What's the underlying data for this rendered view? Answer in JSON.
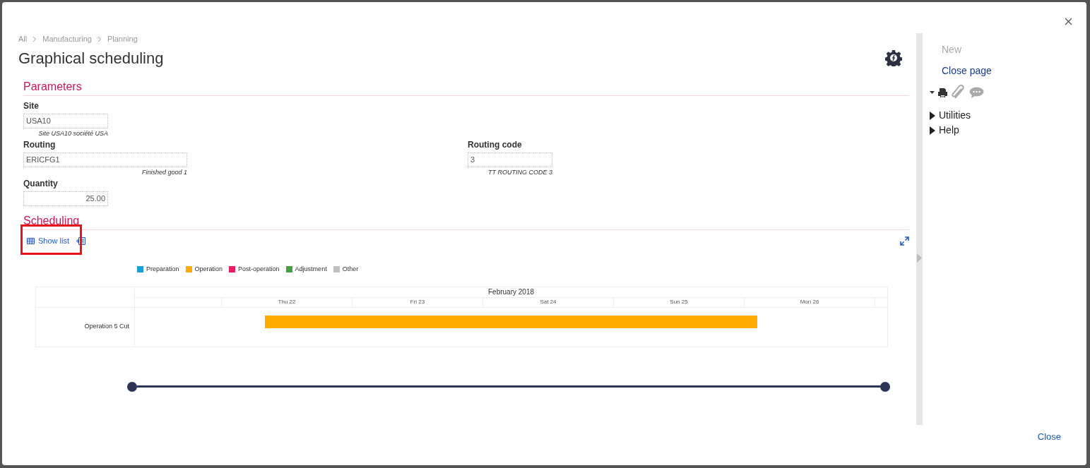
{
  "breadcrumb": [
    "All",
    "Manufacturing",
    "Planning"
  ],
  "title": "Graphical scheduling",
  "parameters": {
    "heading": "Parameters",
    "fields": [
      {
        "label": "Site",
        "value": "USA10",
        "note": "Site USA10 société USA",
        "kind": "text"
      },
      {
        "label": "Routing",
        "value": "ERICFG1",
        "note": "Finished good 1",
        "kind": "text"
      },
      {
        "label": "Routing code",
        "value": "3",
        "note": "TT ROUTING CODE 3",
        "kind": "text"
      },
      {
        "label": "Quantity",
        "value": "25.00",
        "kind": "numeric"
      }
    ]
  },
  "scheduling": {
    "heading": "Scheduling",
    "show_list": "Show list",
    "legend": [
      {
        "label": "Preparation",
        "color": "#1ba1d0"
      },
      {
        "label": "Operation",
        "color": "#ffaa00"
      },
      {
        "label": "Post-operation",
        "color": "#e91e63"
      },
      {
        "label": "Adjustment",
        "color": "#43a047"
      },
      {
        "label": "Other",
        "color": "#c0c0c0"
      }
    ],
    "gantt": {
      "month": "February 2018",
      "days": [
        "Thu 22",
        "Fri 23",
        "Sat 24",
        "Sun 25",
        "Mon 26"
      ],
      "rows": [
        {
          "label": "Operation 5 Cut",
          "color": "#ffaa00"
        }
      ]
    },
    "range_slider": {
      "level": 1
    }
  },
  "side_panel": {
    "actions": [
      {
        "label": "New",
        "disabled": true
      },
      {
        "label": "Close page",
        "disabled": false
      }
    ],
    "sections": [
      {
        "label": "Utilities",
        "expanded": false
      },
      {
        "label": "Help",
        "expanded": false
      }
    ]
  },
  "footer": {
    "close": "Close"
  }
}
